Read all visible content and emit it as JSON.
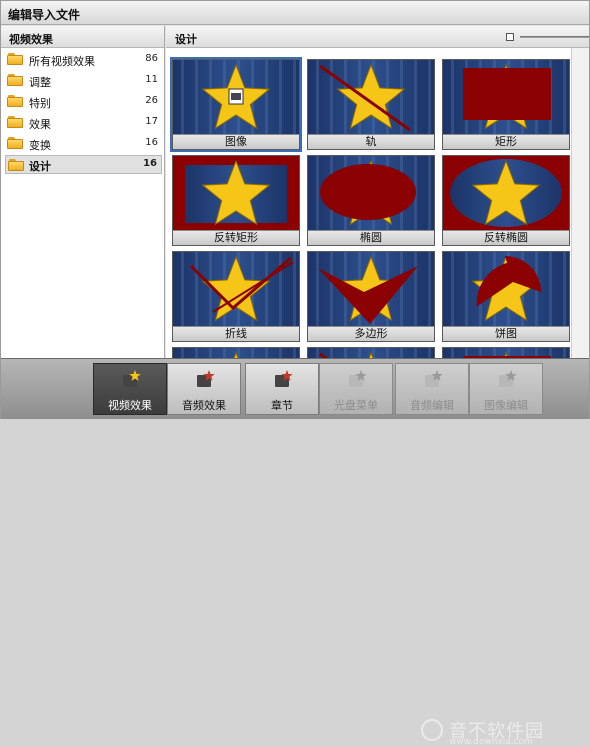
{
  "window": {
    "title": "编辑导入文件"
  },
  "sidebar": {
    "header": "视频效果",
    "items": [
      {
        "label": "所有视频效果",
        "count": "86",
        "active": false
      },
      {
        "label": "调整",
        "count": "11",
        "active": false
      },
      {
        "label": "特别",
        "count": "26",
        "active": false
      },
      {
        "label": "效果",
        "count": "17",
        "active": false
      },
      {
        "label": "变换",
        "count": "16",
        "active": false
      },
      {
        "label": "设计",
        "count": "16",
        "active": true
      }
    ]
  },
  "main": {
    "header": "设计",
    "tiles": [
      {
        "label": "图像",
        "shape": "image",
        "selected": true
      },
      {
        "label": "轨",
        "shape": "track"
      },
      {
        "label": "矩形",
        "shape": "rect"
      },
      {
        "label": "反转矩形",
        "shape": "inv-rect"
      },
      {
        "label": "椭圆",
        "shape": "ellipse"
      },
      {
        "label": "反转椭圆",
        "shape": "inv-ellipse"
      },
      {
        "label": "折线",
        "shape": "polyline"
      },
      {
        "label": "多边形",
        "shape": "polygon"
      },
      {
        "label": "饼图",
        "shape": "pie"
      }
    ]
  },
  "toolbar": {
    "buttons": [
      {
        "label": "视频效果",
        "state": "active",
        "icon": "video-effects-icon"
      },
      {
        "label": "音频效果",
        "state": "normal",
        "icon": "audio-effects-icon"
      },
      {
        "label": "章节",
        "state": "normal",
        "icon": "chapters-icon"
      },
      {
        "label": "光盘菜单",
        "state": "disabled",
        "icon": "disc-menu-icon"
      },
      {
        "label": "音频编辑",
        "state": "disabled",
        "icon": "audio-edit-icon"
      },
      {
        "label": "图像编辑",
        "state": "disabled",
        "icon": "image-edit-icon"
      }
    ]
  },
  "watermark": {
    "text": "音不软件园",
    "url": "www.downxia.com"
  },
  "colors": {
    "shape": "#8b0000",
    "star": "#f5c518",
    "bg": "#2d4f8e",
    "selection": "#3a6fb8"
  }
}
